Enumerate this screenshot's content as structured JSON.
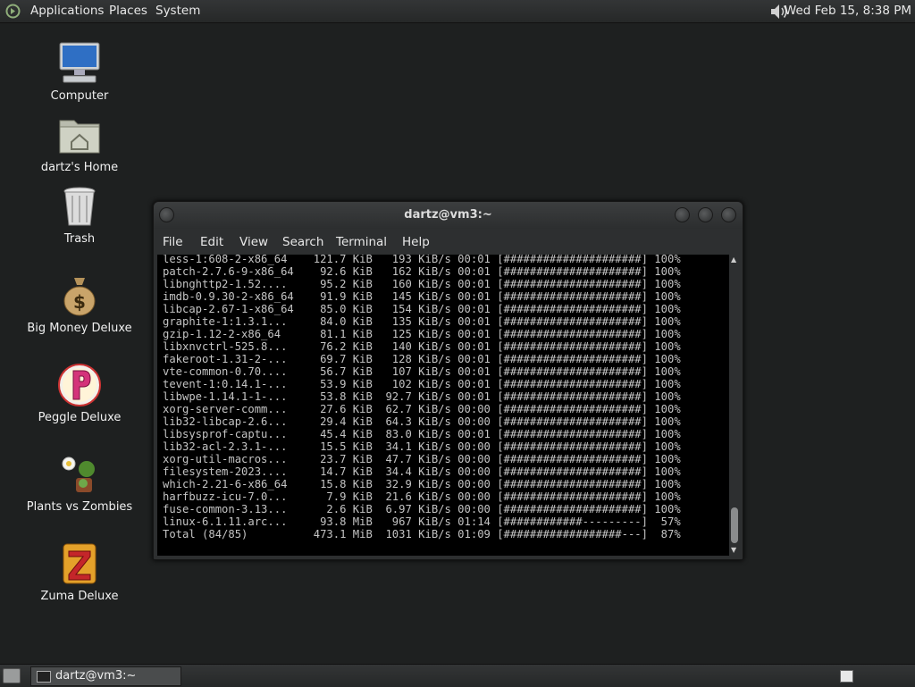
{
  "top_panel": {
    "menus": [
      "Applications",
      "Places",
      "System"
    ],
    "clock": "Wed Feb 15,  8:38 PM"
  },
  "desktop_icons": [
    {
      "label": "Computer",
      "icon": "computer-icon"
    },
    {
      "label": "dartz's Home",
      "icon": "home-folder-icon"
    },
    {
      "label": "Trash",
      "icon": "trash-icon"
    },
    {
      "label": "Big Money Deluxe",
      "icon": "money-bag-icon"
    },
    {
      "label": "Peggle Deluxe",
      "icon": "peggle-icon"
    },
    {
      "label": "Plants vs Zombies",
      "icon": "plants-icon"
    },
    {
      "label": "Zuma Deluxe",
      "icon": "zuma-icon"
    }
  ],
  "terminal": {
    "title": "dartz@vm3:~",
    "menus": [
      "File",
      "Edit",
      "View",
      "Search",
      "Terminal",
      "Help"
    ],
    "lines": [
      "less-1:608-2-x86_64    121.7 KiB   193 KiB/s 00:01 [#####################] 100%",
      "patch-2.7.6-9-x86_64    92.6 KiB   162 KiB/s 00:01 [#####################] 100%",
      "libnghttp2-1.52....     95.2 KiB   160 KiB/s 00:01 [#####################] 100%",
      "imdb-0.9.30-2-x86_64    91.9 KiB   145 KiB/s 00:01 [#####################] 100%",
      "libcap-2.67-1-x86_64    85.0 KiB   154 KiB/s 00:01 [#####################] 100%",
      "graphite-1:1.3.1...     84.0 KiB   135 KiB/s 00:01 [#####################] 100%",
      "gzip-1.12-2-x86_64      81.1 KiB   125 KiB/s 00:01 [#####################] 100%",
      "libxnvctrl-525.8...     76.2 KiB   140 KiB/s 00:01 [#####################] 100%",
      "fakeroot-1.31-2-...     69.7 KiB   128 KiB/s 00:01 [#####################] 100%",
      "vte-common-0.70....     56.7 KiB   107 KiB/s 00:01 [#####################] 100%",
      "tevent-1:0.14.1-...     53.9 KiB   102 KiB/s 00:01 [#####################] 100%",
      "libwpe-1.14.1-1-...     53.8 KiB  92.7 KiB/s 00:01 [#####################] 100%",
      "xorg-server-comm...     27.6 KiB  62.7 KiB/s 00:00 [#####################] 100%",
      "lib32-libcap-2.6...     29.4 KiB  64.3 KiB/s 00:00 [#####################] 100%",
      "libsysprof-captu...     45.4 KiB  83.0 KiB/s 00:01 [#####################] 100%",
      "lib32-acl-2.3.1-...     15.5 KiB  34.1 KiB/s 00:00 [#####################] 100%",
      "xorg-util-macros...     23.7 KiB  47.7 KiB/s 00:00 [#####################] 100%",
      "filesystem-2023....     14.7 KiB  34.4 KiB/s 00:00 [#####################] 100%",
      "which-2.21-6-x86_64     15.8 KiB  32.9 KiB/s 00:00 [#####################] 100%",
      "harfbuzz-icu-7.0...      7.9 KiB  21.6 KiB/s 00:00 [#####################] 100%",
      "fuse-common-3.13...      2.6 KiB  6.97 KiB/s 00:00 [#####################] 100%",
      "linux-6.1.11.arc...     93.8 MiB   967 KiB/s 01:14 [############---------]  57%",
      "Total (84/85)          473.1 MiB  1031 KiB/s 01:09 [##################---]  87%"
    ]
  },
  "taskbar": {
    "task_label": "dartz@vm3:~"
  },
  "colors": {
    "desktop": "#1e2020",
    "panel": "#2c2e2f",
    "terminal_bg": "#000000",
    "terminal_fg": "#c4c4c4"
  }
}
